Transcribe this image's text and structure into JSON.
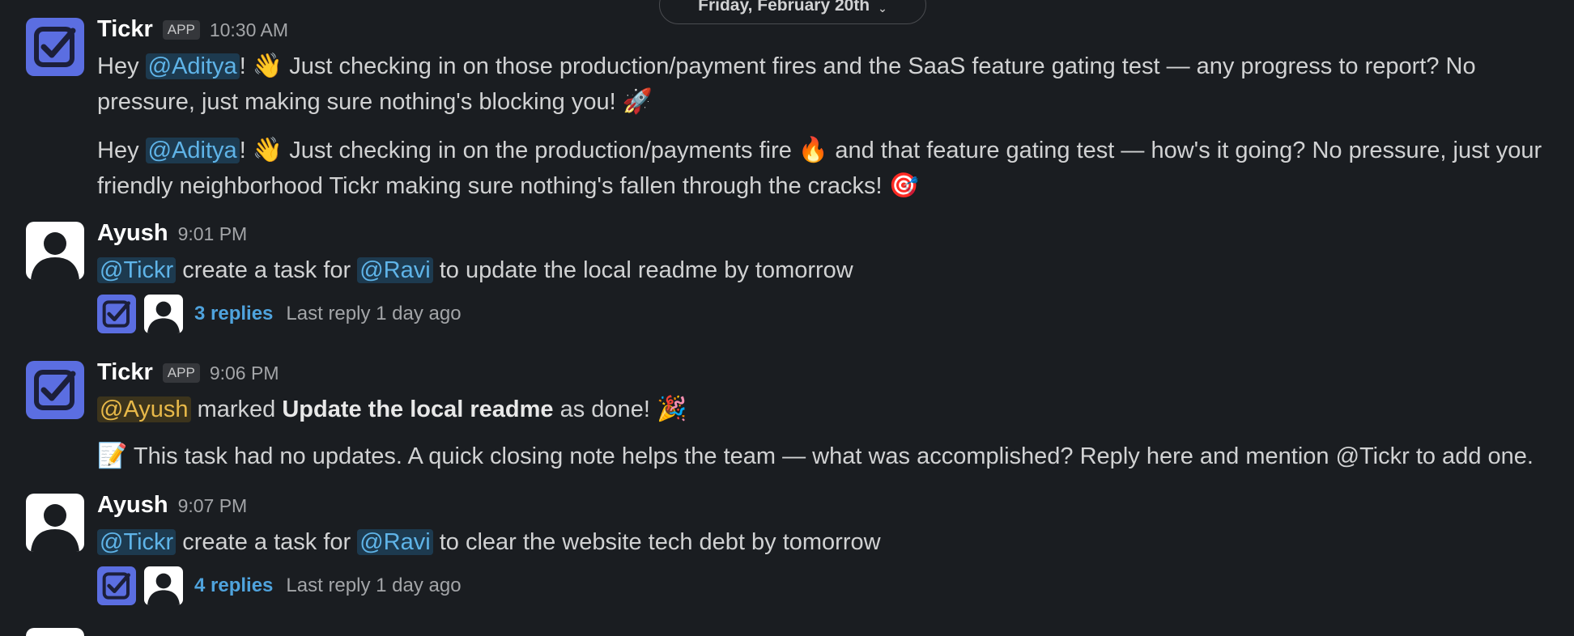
{
  "date_divider": {
    "label": "Friday, February 20th"
  },
  "messages": [
    {
      "name": "Tickr",
      "badge": "APP",
      "time": "10:30 AM",
      "p1": {
        "a": "Hey ",
        "mention": "@Aditya",
        "b": "! ",
        "emoji": "👋",
        "c": " Just checking in on those production/payment fires and the SaaS feature gating test — any progress to report? No pressure, just making sure nothing's blocking you! ",
        "emoji2": "🚀"
      },
      "p2": {
        "a": "Hey ",
        "mention": "@Aditya",
        "b": "! ",
        "emoji": "👋",
        "c": " Just checking in on the production/payments fire ",
        "emoji2": "🔥",
        "d": " and that feature gating test — how's it going? No pressure, just your friendly neighborhood Tickr making sure nothing's fallen through the cracks! ",
        "emoji3": "🎯"
      }
    },
    {
      "name": "Ayush",
      "time": "9:01 PM",
      "mention1": "@Tickr",
      "a": " create a task for ",
      "mention2": "@Ravi",
      "b": " to update the local readme by tomorrow",
      "thread": {
        "replies": "3 replies",
        "last": "Last reply 1 day ago"
      }
    },
    {
      "name": "Tickr",
      "badge": "APP",
      "time": "9:06 PM",
      "mention": "@Ayush",
      "a": " marked ",
      "task": "Update the local readme",
      "b": " as done! ",
      "emoji": "🎉",
      "note_emoji": "📝",
      "note": " This task had no updates. A quick closing note helps the team — what was accomplished? Reply here and mention @Tickr to add one."
    },
    {
      "name": "Ayush",
      "time": "9:07 PM",
      "mention1": "@Tickr",
      "a": " create a task for ",
      "mention2": "@Ravi",
      "b": " to clear the website tech debt by tomorrow",
      "thread": {
        "replies": "4 replies",
        "last": "Last reply 1 day ago"
      }
    }
  ],
  "colors": {
    "background": "#1a1d21",
    "tickr_brand": "#5b6ee1",
    "link": "#4fa3dd"
  }
}
